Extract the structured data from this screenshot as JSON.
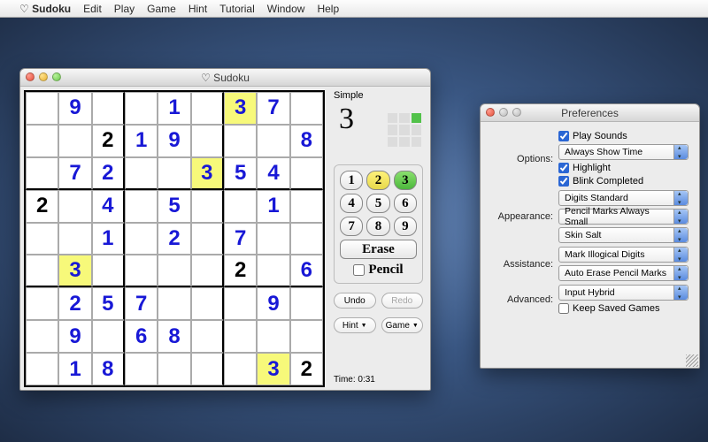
{
  "menubar": {
    "app_icon": "♡",
    "app_name": "Sudoku",
    "items": [
      "Edit",
      "Play",
      "Game",
      "Hint",
      "Tutorial",
      "Window",
      "Help"
    ]
  },
  "main_window": {
    "title": "♡ Sudoku",
    "difficulty": "Simple",
    "selected_number": "3",
    "progress_done_index": 2,
    "numpad": [
      "1",
      "2",
      "3",
      "4",
      "5",
      "6",
      "7",
      "8",
      "9"
    ],
    "numpad_yellow": 2,
    "numpad_green": 3,
    "erase_label": "Erase",
    "pencil_label": "Pencil",
    "pencil_checked": false,
    "undo_label": "Undo",
    "redo_label": "Redo",
    "hint_label": "Hint",
    "game_label": "Game",
    "time_label": "Time: 0:31",
    "board": [
      [
        "",
        "9",
        "",
        "",
        "1",
        "",
        "3",
        "7",
        ""
      ],
      [
        "",
        "",
        "2",
        "1",
        "9",
        "",
        "",
        "",
        "8"
      ],
      [
        "",
        "7",
        "2",
        "",
        "",
        "3",
        "5",
        "4",
        ""
      ],
      [
        "2",
        "",
        "4",
        "",
        "5",
        "",
        "",
        "1",
        ""
      ],
      [
        "",
        "",
        "1",
        "",
        "2",
        "",
        "7",
        "",
        ""
      ],
      [
        "",
        "3",
        "",
        "",
        "",
        "",
        "2",
        "",
        "6"
      ],
      [
        "",
        "2",
        "5",
        "7",
        "",
        "",
        "",
        "9",
        ""
      ],
      [
        "",
        "9",
        "",
        "6",
        "8",
        "",
        "",
        "",
        ""
      ],
      [
        "",
        "1",
        "8",
        "",
        "",
        "",
        "",
        "3",
        "2"
      ]
    ],
    "given_cells": [
      "1,2",
      "2,8",
      "3,0",
      "5,6",
      "7,5",
      "7,6",
      "8,8"
    ],
    "highlight_cells": [
      "0,6",
      "2,5",
      "5,1",
      "8,7"
    ]
  },
  "pref_window": {
    "title": "Preferences",
    "groups": {
      "options_label": "Options:",
      "appearance_label": "Appearance:",
      "assistance_label": "Assistance:",
      "advanced_label": "Advanced:"
    },
    "options": {
      "play_sounds": {
        "label": "Play Sounds",
        "checked": true
      },
      "time_select": "Always Show Time",
      "highlight": {
        "label": "Highlight",
        "checked": true
      },
      "blink": {
        "label": "Blink Completed",
        "checked": true
      }
    },
    "appearance": {
      "digits": "Digits Standard",
      "pencil": "Pencil Marks Always Small",
      "skin": "Skin Salt"
    },
    "assistance": {
      "illogical": "Mark Illogical Digits",
      "autoerase": "Auto Erase Pencil Marks"
    },
    "advanced": {
      "input": "Input Hybrid",
      "keep_saved": {
        "label": "Keep Saved Games",
        "checked": false
      }
    }
  }
}
